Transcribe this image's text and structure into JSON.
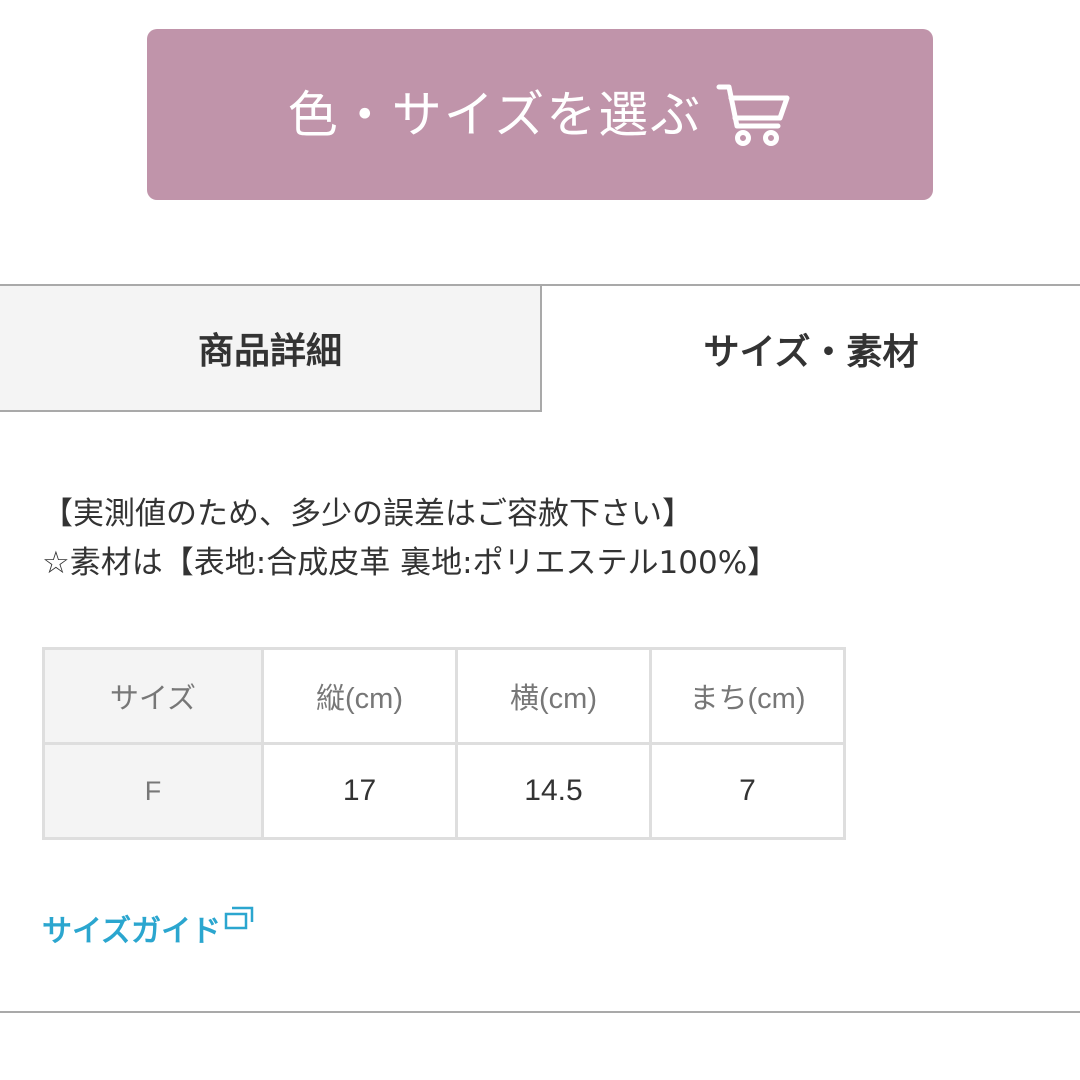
{
  "select_button": {
    "label": "色・サイズを選ぶ",
    "icon": "cart-icon",
    "background_color": "#c094aa"
  },
  "tabs": [
    {
      "label": "商品詳細",
      "active": false
    },
    {
      "label": "サイズ・素材",
      "active": true
    }
  ],
  "notes": {
    "line1": "【実測値のため、多少の誤差はご容赦下さい】",
    "line2": "☆素材は【表地:合成皮革 裏地:ポリエステル100%】"
  },
  "size_table": {
    "headers": [
      "サイズ",
      "縦(cm)",
      "横(cm)",
      "まち(cm)"
    ],
    "rows": [
      [
        "F",
        "17",
        "14.5",
        "7"
      ]
    ]
  },
  "size_guide": {
    "label": "サイズガイド",
    "icon": "external-link-icon",
    "color": "#2ba6cf"
  }
}
